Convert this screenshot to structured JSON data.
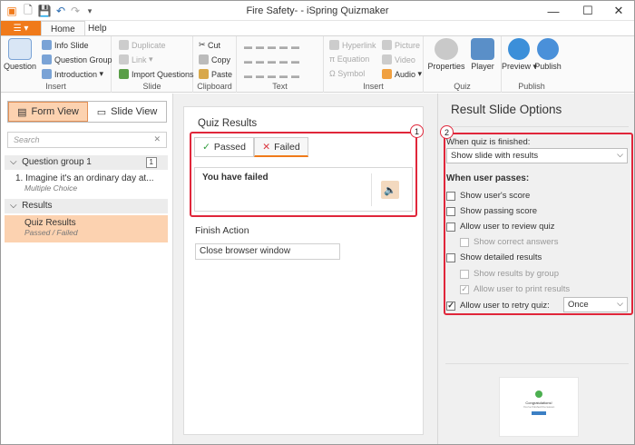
{
  "window": {
    "title": "Fire Safety- - iSpring Quizmaker"
  },
  "ribbon_tabs": [
    "Home",
    "Help"
  ],
  "ribbon": {
    "insert1": {
      "question": "Question",
      "info_slide": "Info Slide",
      "question_group": "Question Group",
      "introduction": "Introduction",
      "label": "Insert"
    },
    "slide": {
      "duplicate": "Duplicate",
      "link": "Link",
      "import_questions": "Import Questions",
      "label": "Slide"
    },
    "clipboard": {
      "cut": "Cut",
      "copy": "Copy",
      "paste": "Paste",
      "label": "Clipboard"
    },
    "text": {
      "label": "Text"
    },
    "insert2": {
      "hyperlink": "Hyperlink",
      "equation": "Equation",
      "symbol": "Symbol",
      "picture": "Picture",
      "video": "Video",
      "audio": "Audio",
      "label": "Insert"
    },
    "quiz": {
      "properties": "Properties",
      "player": "Player",
      "label": "Quiz"
    },
    "publish": {
      "preview": "Preview",
      "publish": "Publish",
      "label": "Publish"
    }
  },
  "left": {
    "form_view": "Form View",
    "slide_view": "Slide View",
    "search_placeholder": "Search",
    "group1": {
      "label": "Question group 1",
      "count": "1"
    },
    "q1": {
      "title": "1.  Imagine it's an ordinary day at...",
      "type": "Multiple Choice"
    },
    "results": "Results",
    "quiz_results": {
      "title": "Quiz Results",
      "sub": "Passed / Failed"
    }
  },
  "center": {
    "title": "Quiz Results",
    "tab_passed": "Passed",
    "tab_failed": "Failed",
    "message": "You have failed",
    "finish_action_label": "Finish Action",
    "finish_action_value": "Close browser window",
    "badge1": "1"
  },
  "right": {
    "title": "Result Slide Options",
    "when_finished": "When quiz is finished:",
    "when_finished_value": "Show slide with results",
    "when_passes": "When user passes:",
    "opts": {
      "show_score": "Show user's score",
      "show_passing": "Show passing score",
      "allow_review": "Allow user to review quiz",
      "show_correct": "Show correct answers",
      "show_detailed": "Show detailed results",
      "show_by_group": "Show results by group",
      "allow_print": "Allow user to print results",
      "allow_retry": "Allow user to retry quiz:"
    },
    "retry_value": "Once",
    "badge2": "2",
    "preview": {
      "heading": "Congratulations!",
      "line": "You've finished the lesson"
    }
  }
}
